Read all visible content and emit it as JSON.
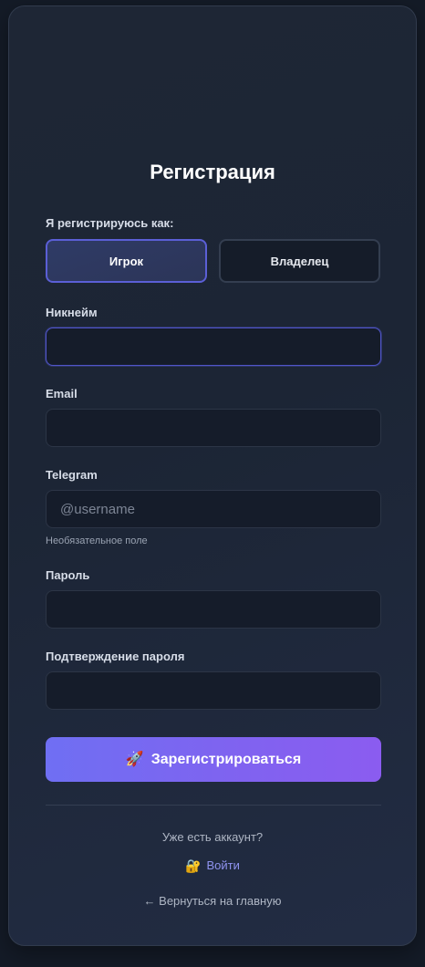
{
  "form": {
    "title": "Регистрация",
    "role_label": "Я регистрируюсь как:",
    "roles": [
      {
        "label": "Игрок",
        "selected": true
      },
      {
        "label": "Владелец",
        "selected": false
      }
    ],
    "nickname": {
      "label": "Никнейм",
      "value": "",
      "placeholder": ""
    },
    "email": {
      "label": "Email",
      "value": "",
      "placeholder": ""
    },
    "telegram": {
      "label": "Telegram",
      "value": "",
      "placeholder": "@username",
      "hint": "Необязательное поле"
    },
    "password": {
      "label": "Пароль",
      "value": "",
      "placeholder": ""
    },
    "confirm_password": {
      "label": "Подтверждение пароля",
      "value": "",
      "placeholder": ""
    },
    "submit": {
      "icon": "rocket-icon",
      "icon_glyph": "🚀",
      "label": "Зарегистрироваться"
    }
  },
  "footer": {
    "have_account": "Уже есть аккаунт?",
    "login": {
      "icon": "lock-icon",
      "icon_glyph": "🔐",
      "label": "Войти"
    },
    "back": "← Вернуться на главную"
  },
  "colors": {
    "accent": "#6f6ff3",
    "accent_end": "#8b5cf0",
    "link": "#8f93f0",
    "selected_border": "#5b5fd6"
  }
}
